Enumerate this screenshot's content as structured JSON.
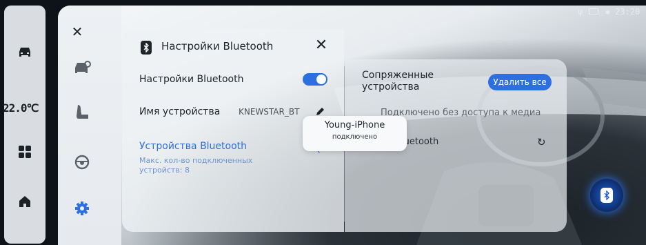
{
  "status_bar": {
    "time": "23:20",
    "usb_icon": "usb-icon",
    "battery_icon": "battery-icon",
    "bluetooth_icon": "bluetooth-off-icon"
  },
  "dock": {
    "temperature": "22.0℃",
    "items": [
      "car-icon",
      "apps-grid-icon",
      "home-icon"
    ]
  },
  "rail": {
    "close_icon": "close-icon",
    "items": [
      "car-settings-icon",
      "seat-icon",
      "steering-wheel-icon",
      "gear-icon"
    ],
    "active": "gear-icon"
  },
  "panel": {
    "title": "Настройки Bluetooth",
    "bluetooth_toggle_label": "Настройки Bluetooth",
    "bluetooth_toggle_on": true,
    "device_name_label": "Имя устройства",
    "device_name_value": "KNEWSTAR_BT",
    "bt_devices_link": "Устройства Bluetooth",
    "max_devices_note": "Макс. кол-во подключенных устройств: 8",
    "paired_title": "Сопряженные устройства",
    "delete_all_button": "Удалить все",
    "connected_no_media": "Подключено без доступа к медиа",
    "bluetooth_fragment": "luetooth"
  },
  "toast": {
    "title": "Young-iPhone",
    "subtitle": "подключено"
  },
  "colors": {
    "accent": "#2d6fe0",
    "link": "#2f6fd8",
    "panel": "#eef1f4"
  }
}
